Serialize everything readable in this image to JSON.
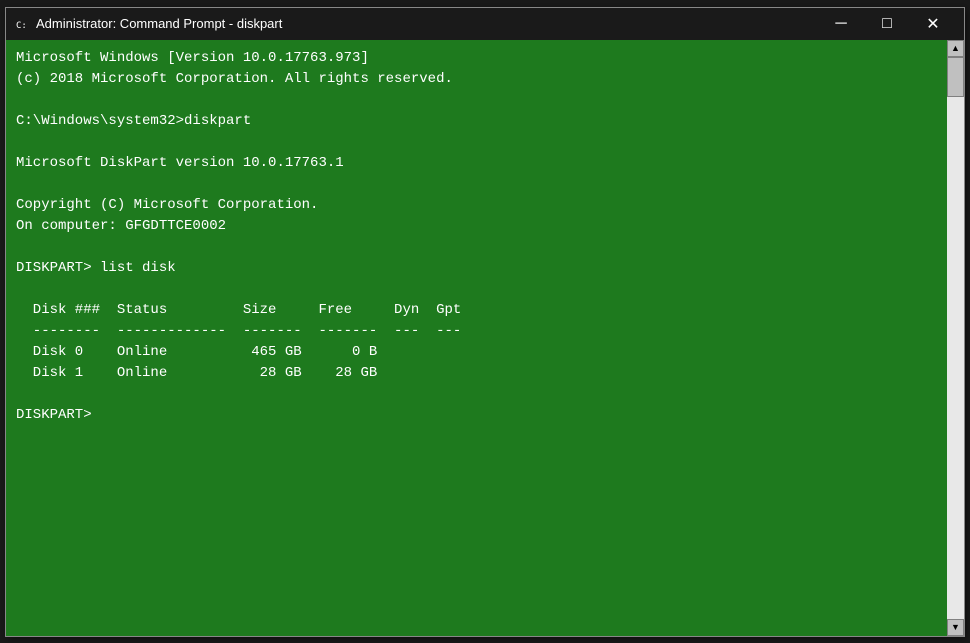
{
  "window": {
    "title": "Administrator: Command Prompt - diskpart",
    "icon": "CMD"
  },
  "titlebar": {
    "minimize_label": "─",
    "maximize_label": "□",
    "close_label": "✕"
  },
  "terminal": {
    "lines": [
      "Microsoft Windows [Version 10.0.17763.973]",
      "(c) 2018 Microsoft Corporation. All rights reserved.",
      "",
      "C:\\Windows\\system32>diskpart",
      "",
      "Microsoft DiskPart version 10.0.17763.1",
      "",
      "Copyright (C) Microsoft Corporation.",
      "On computer: GFGDTTCE0002",
      "",
      "DISKPART> list disk",
      "",
      "  Disk ###  Status         Size     Free     Dyn  Gpt",
      "  --------  -------------  -------  -------  ---  ---",
      "  Disk 0    Online          465 GB      0 B",
      "  Disk 1    Online           28 GB    28 GB",
      "",
      "DISKPART> "
    ]
  }
}
